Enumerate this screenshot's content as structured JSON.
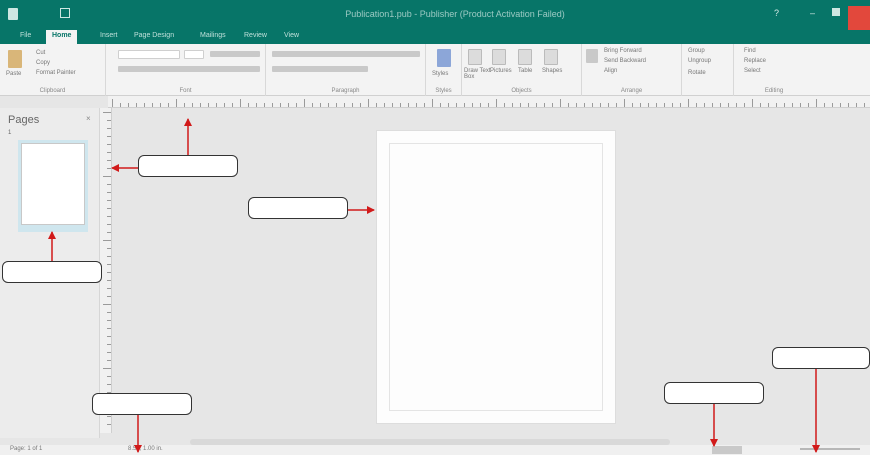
{
  "title_bar": {
    "title": "Publication1.pub - Publisher (Product Activation Failed)",
    "help_label": "?",
    "minimize_label": "–"
  },
  "ribbon_tabs": [
    {
      "label": "File"
    },
    {
      "label": "Home"
    },
    {
      "label": "Insert"
    },
    {
      "label": "Page Design"
    },
    {
      "label": "Mailings"
    },
    {
      "label": "Review"
    },
    {
      "label": "View"
    }
  ],
  "ribbon": {
    "groups": [
      {
        "label": "Clipboard"
      },
      {
        "label": "Font"
      },
      {
        "label": "Paragraph"
      },
      {
        "label": "Styles"
      },
      {
        "label": "Objects"
      },
      {
        "label": "Arrange"
      },
      {
        "label": "Editing"
      }
    ],
    "clipboard": {
      "paste": "Paste",
      "cut": "Cut",
      "copy": "Copy",
      "format_painter": "Format Painter"
    },
    "styles": {
      "styles": "Styles"
    },
    "objects": {
      "draw_text_box": "Draw Text Box",
      "pictures": "Pictures",
      "table": "Table",
      "shapes": "Shapes"
    },
    "arrange": {
      "bring_forward": "Bring Forward",
      "send_backward": "Send Backward",
      "align": "Align"
    },
    "group": {
      "group": "Group",
      "ungroup": "Ungroup",
      "rotate": "Rotate"
    },
    "editing": {
      "find": "Find",
      "replace": "Replace",
      "select": "Select"
    }
  },
  "pages_pane": {
    "title": "Pages",
    "close_label": "×",
    "page_number": "1"
  },
  "status_bar": {
    "page": "Page: 1 of 1",
    "position": "8.50, 1.00 in."
  },
  "callouts": [
    {
      "label": ""
    },
    {
      "label": ""
    },
    {
      "label": ""
    },
    {
      "label": ""
    },
    {
      "label": ""
    },
    {
      "label": ""
    }
  ],
  "colors": {
    "title_bar": "#077568",
    "arrow": "#d11a1a",
    "account_badge": "#e2483c"
  }
}
